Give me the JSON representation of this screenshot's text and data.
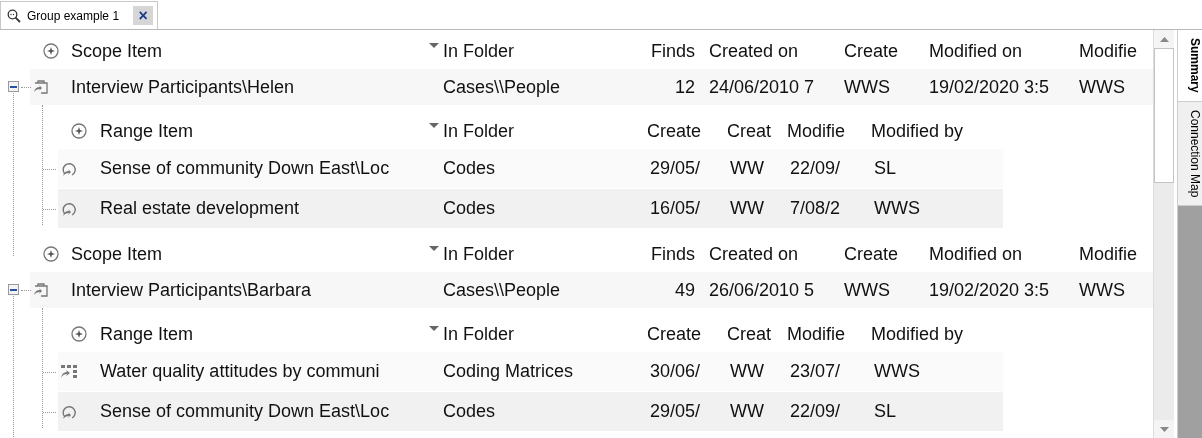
{
  "tab": {
    "label": "Group example 1",
    "close": "×",
    "selected": true
  },
  "groups": [
    {
      "expanded": true,
      "scope_header": [
        {
          "label": "Scope Item",
          "sorted": false
        },
        {
          "label": "In Folder",
          "sorted": true
        },
        {
          "label": "Finds",
          "sorted": false
        },
        {
          "label": "Created on",
          "sorted": false
        },
        {
          "label": "Create",
          "sorted": false
        },
        {
          "label": "Modified on",
          "sorted": false
        },
        {
          "label": "Modifie",
          "sorted": false
        }
      ],
      "scope_row": [
        "Interview Participants\\Helen",
        "Cases\\\\People",
        "12",
        "24/06/2010 7",
        "WWS",
        "19/02/2020 3:5",
        "WWS"
      ],
      "range_header": [
        {
          "label": "Range Item",
          "sorted": false
        },
        {
          "label": "In Folder",
          "sorted": true
        },
        {
          "label": "Create",
          "sorted": false
        },
        {
          "label": "Creat",
          "sorted": false
        },
        {
          "label": "Modifie",
          "sorted": false
        },
        {
          "label": "Modified by",
          "sorted": false
        }
      ],
      "range_rows": [
        {
          "kind": "code",
          "cells": [
            "Sense of community Down East\\Loc",
            "Codes",
            "29/05/",
            "WW",
            "22/09/",
            "SL"
          ]
        },
        {
          "kind": "code",
          "cells": [
            "Real estate development",
            "Codes",
            "16/05/",
            "WW",
            "7/08/2",
            "WWS"
          ]
        }
      ]
    },
    {
      "expanded": true,
      "scope_header": [
        {
          "label": "Scope Item",
          "sorted": false
        },
        {
          "label": "In Folder",
          "sorted": true
        },
        {
          "label": "Finds",
          "sorted": false
        },
        {
          "label": "Created on",
          "sorted": false
        },
        {
          "label": "Create",
          "sorted": false
        },
        {
          "label": "Modified on",
          "sorted": false
        },
        {
          "label": "Modifie",
          "sorted": false
        }
      ],
      "scope_row": [
        "Interview Participants\\Barbara",
        "Cases\\\\People",
        "49",
        "26/06/2010 5",
        "WWS",
        "19/02/2020 3:5",
        "WWS"
      ],
      "range_header": [
        {
          "label": "Range Item",
          "sorted": false
        },
        {
          "label": "In Folder",
          "sorted": true
        },
        {
          "label": "Create",
          "sorted": false
        },
        {
          "label": "Creat",
          "sorted": false
        },
        {
          "label": "Modifie",
          "sorted": false
        },
        {
          "label": "Modified by",
          "sorted": false
        }
      ],
      "range_rows": [
        {
          "kind": "matrix",
          "cells": [
            "Water quality attitudes by communi",
            "Coding Matrices",
            "30/06/",
            "WW",
            "23/07/",
            "WWS"
          ]
        },
        {
          "kind": "code",
          "cells": [
            "Sense of community Down East\\Loc",
            "Codes",
            "29/05/",
            "WW",
            "22/09/",
            "SL"
          ]
        }
      ]
    }
  ],
  "side_tabs": [
    {
      "label": "Summary",
      "selected": true
    },
    {
      "label": "Connection Map",
      "selected": false
    }
  ]
}
